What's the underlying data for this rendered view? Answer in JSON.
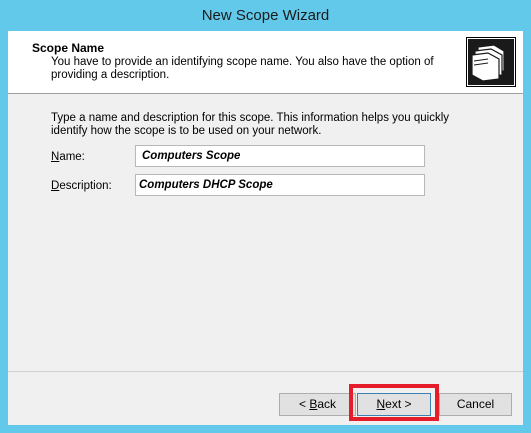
{
  "window": {
    "title": "New Scope Wizard"
  },
  "header": {
    "title": "Scope Name",
    "description": "You have to provide an identifying scope name. You also have the option of providing a description.",
    "icon": "folder-stack-icon"
  },
  "body": {
    "instructions": "Type a name and description for this scope. This information helps you quickly identify how the scope is to be used on your network.",
    "name_label_mnemonic": "N",
    "name_label_rest": "ame:",
    "name_value": "Computers Scope",
    "description_label_mnemonic": "D",
    "description_label_rest": "escription:",
    "description_value": "Computers DHCP Scope"
  },
  "buttons": {
    "back_prefix": "< ",
    "back_mnemonic": "B",
    "back_rest": "ack",
    "next_mnemonic": "N",
    "next_rest": "ext >",
    "cancel": "Cancel"
  },
  "colors": {
    "frame": "#62c9ea",
    "highlight": "#e51d2a"
  }
}
